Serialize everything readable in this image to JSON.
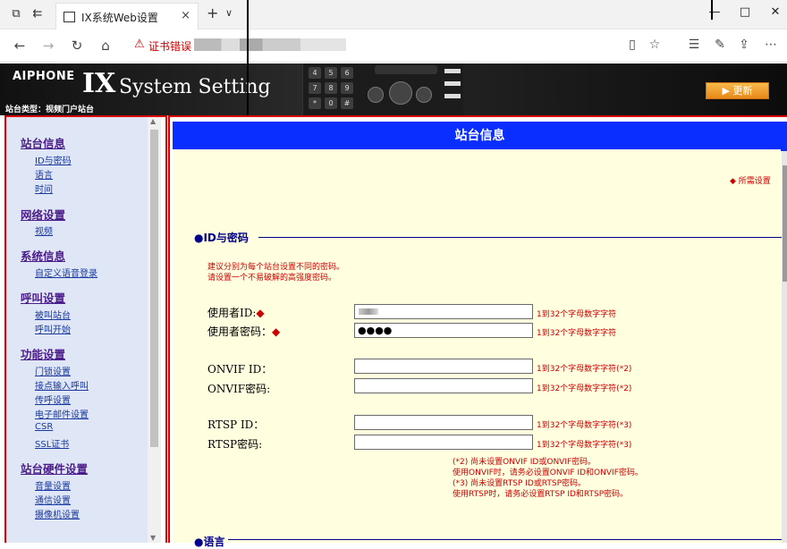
{
  "browser": {
    "tab_title": "IX系统Web设置",
    "tab_close": "×",
    "new_tab": "+",
    "tab_menu": "∨",
    "cert_error": "证书错误",
    "minimize": "—",
    "maximize": "□",
    "close": "✕"
  },
  "banner": {
    "brand": "AIPHONE",
    "logo": "IX",
    "title": "System Setting",
    "station_type": "站台类型：视频门户站台",
    "update_button": "更新"
  },
  "sidebar": {
    "sections": [
      {
        "title": "站台信息",
        "items": [
          "ID与密码",
          "语言",
          "时间"
        ]
      },
      {
        "title": "网络设置",
        "items": [
          "视频"
        ]
      },
      {
        "title": "系统信息",
        "items": [
          "自定义语音登录"
        ]
      },
      {
        "title": "呼叫设置",
        "items": [
          "被叫站台",
          "呼叫开始"
        ]
      },
      {
        "title": "功能设置",
        "items": [
          "门锁设置",
          "接点输入呼叫",
          "传呼设置",
          "电子邮件设置",
          "CSR",
          "SSL证书"
        ]
      },
      {
        "title": "站台硬件设置",
        "items": [
          "音量设置",
          "通信设置",
          "摄像机设置"
        ]
      }
    ]
  },
  "main": {
    "header": "站台信息",
    "required_note": "◆ 所需设置",
    "section_id": "●ID与密码",
    "section_lang": "●语言",
    "advice_lines": [
      "建议分别为每个站台设置不同的密码。",
      "请设置一个不易破解的高强度密码。"
    ],
    "fields": [
      {
        "label": "使用者ID:",
        "required": "◆",
        "value": "",
        "hint": "1到32个字母数字字符"
      },
      {
        "label": "使用者密码：",
        "required": "◆",
        "value": "●●●●",
        "hint": "1到32个字母数字字符"
      },
      {
        "label": "ONVIF ID：",
        "required": "",
        "value": "",
        "hint": "1到32个字母数字字符(*2)"
      },
      {
        "label": "ONVIF密码:",
        "required": "",
        "value": "",
        "hint": "1到32个字母数字字符(*2)"
      },
      {
        "label": "RTSP ID：",
        "required": "",
        "value": "",
        "hint": "1到32个字母数字字符(*3)"
      },
      {
        "label": "RTSP密码:",
        "required": "",
        "value": "",
        "hint": "1到32个字母数字字符(*3)"
      }
    ],
    "footnotes": [
      "(*2) 尚未设置ONVIF ID或ONVIF密码。",
      "使用ONVIF时，请务必设置ONVIF ID和ONVIF密码。",
      "(*3) 尚未设置RTSP ID或RTSP密码。",
      "使用RTSP时，请务必设置RTSP ID和RTSP密码。"
    ]
  }
}
